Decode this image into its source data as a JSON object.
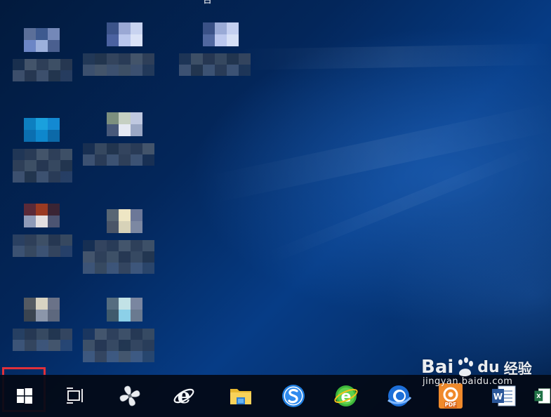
{
  "desktop": {
    "top_clipped_text": "台",
    "icons": [
      {
        "name": "desktop-icon-1",
        "label_blurred": true
      },
      {
        "name": "desktop-icon-2",
        "label_blurred": true
      },
      {
        "name": "desktop-icon-3",
        "label_blurred": true
      },
      {
        "name": "desktop-icon-4",
        "label_blurred": true
      },
      {
        "name": "desktop-icon-5",
        "label_blurred": true
      },
      {
        "name": "desktop-icon-6",
        "label_blurred": true
      },
      {
        "name": "desktop-icon-7",
        "label_blurred": true
      },
      {
        "name": "desktop-icon-8",
        "label_blurred": true
      },
      {
        "name": "desktop-icon-9",
        "label_blurred": true
      }
    ]
  },
  "taskbar": {
    "start_button": {
      "icon": "windows-logo-icon",
      "highlighted": true,
      "highlight_color": "#e0303a"
    },
    "items": [
      {
        "icon": "task-view-icon"
      },
      {
        "icon": "pinwheel-app-icon"
      },
      {
        "icon": "internet-explorer-icon"
      },
      {
        "icon": "file-explorer-icon"
      },
      {
        "icon": "sogou-browser-icon"
      },
      {
        "icon": "360-browser-icon"
      },
      {
        "icon": "qq-browser-icon"
      },
      {
        "icon": "pdf-app-icon"
      },
      {
        "icon": "word-icon"
      },
      {
        "icon": "excel-icon"
      }
    ],
    "pdf_badge": "PDF",
    "word_badge": "W"
  },
  "watermark": {
    "logo_text": "Bai",
    "logo_text_2": "du",
    "logo_cn": "经验",
    "url": "jingyan.baidu.com"
  },
  "colors": {
    "taskbar_bg": "#050b16",
    "accent": "#0a4a9a",
    "highlight": "#e0303a"
  }
}
